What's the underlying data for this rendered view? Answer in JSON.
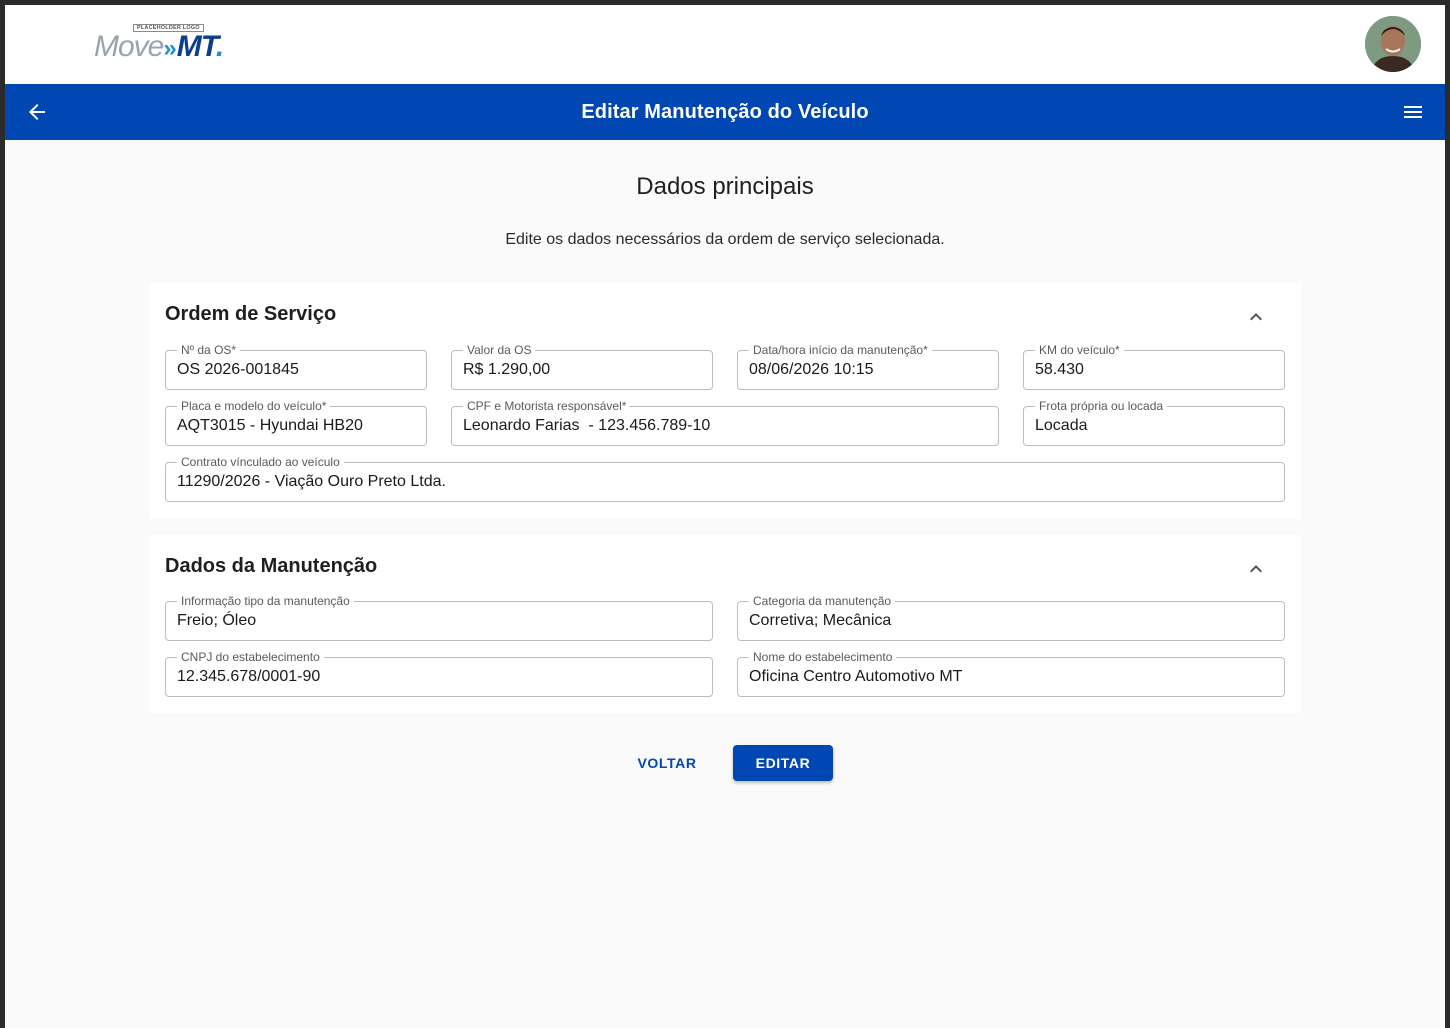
{
  "header": {
    "logo_tag": "PLACEHOLDER LOGO",
    "logo_word": "Move",
    "logo_chevrons": "»",
    "logo_mt": "MT",
    "logo_dot": ".",
    "avatar_icon": "user-avatar"
  },
  "appbar": {
    "title": "Editar Manutenção do Veículo",
    "back_icon": "arrow-left-icon",
    "menu_icon": "hamburger-menu-icon",
    "color": "#0047b3"
  },
  "page": {
    "title": "Dados principais",
    "subtitle": "Edite os dados necessários da ordem de serviço selecionada."
  },
  "ordem_servico": {
    "title": "Ordem de Serviço",
    "fields": {
      "numero": {
        "label": "Nº da  OS*",
        "value": "OS 2026-001845"
      },
      "valor": {
        "label": "Valor da OS",
        "value": "R$ 1.290,00"
      },
      "data_inicio": {
        "label": "Data/hora início da manutenção*",
        "value": "08/06/2026 10:15"
      },
      "km": {
        "label": "KM do veículo*",
        "value": "58.430"
      },
      "placa": {
        "label": "Placa e modelo do veículo*",
        "value": "AQT3015 - Hyundai HB20"
      },
      "motorista": {
        "label": "CPF e Motorista responsável*",
        "value": "Leonardo Farias  - 123.456.789-10"
      },
      "frota": {
        "label": "Frota própria ou locada",
        "value": "Locada"
      },
      "contrato": {
        "label": "Contrato vínculado ao veículo",
        "value": "11290/2026 - Viação Ouro Preto Ltda."
      }
    }
  },
  "dados_manutencao": {
    "title": "Dados da Manutenção",
    "fields": {
      "tipo": {
        "label": "Informação tipo da manutenção",
        "value": "Freio; Óleo"
      },
      "categoria": {
        "label": "Categoria da manutenção",
        "value": "Corretiva; Mecânica"
      },
      "cnpj": {
        "label": "CNPJ do estabelecimento",
        "value": "12.345.678/0001-90"
      },
      "nome": {
        "label": "Nome do estabelecimento",
        "value": "Oficina Centro Automotivo MT"
      }
    }
  },
  "actions": {
    "voltar": "VOLTAR",
    "editar": "EDITAR"
  }
}
